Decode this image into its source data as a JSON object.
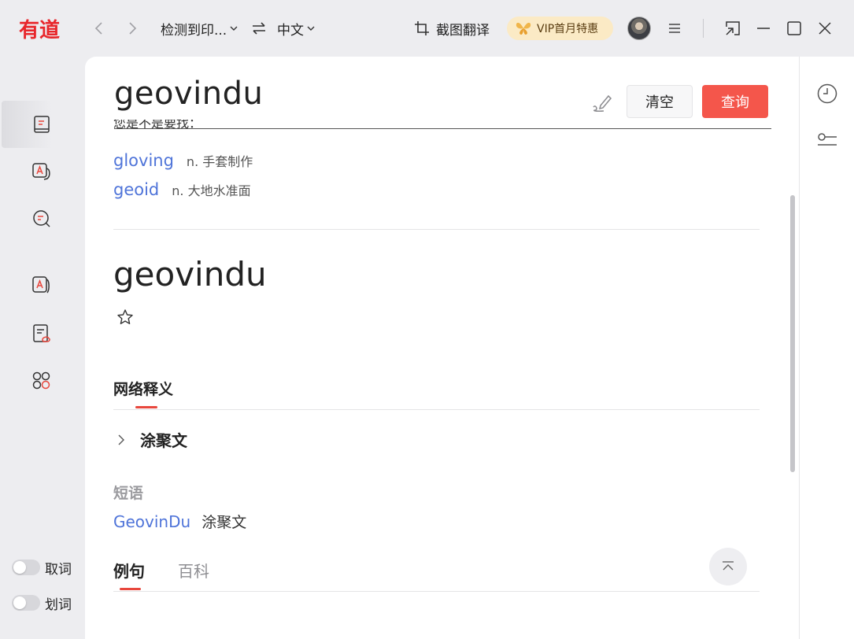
{
  "app": {
    "logo_text": "有道",
    "brand_color": "#e8262b",
    "accent_color": "#f4564b",
    "link_color": "#4f74d9"
  },
  "titlebar": {
    "source_lang": "检测到印...",
    "target_lang": "中文",
    "screenshot_label": "截图翻译",
    "vip_label": "VIP首月特惠",
    "icons": [
      "back-icon",
      "forward-icon",
      "swap-icon",
      "crop-icon",
      "butterfly-icon",
      "menu-icon",
      "mini-mode-icon",
      "minimize-icon",
      "maximize-icon",
      "close-icon"
    ]
  },
  "sidebar": {
    "items": [
      {
        "name": "dictionary",
        "icon": "dictionary-icon",
        "active": true
      },
      {
        "name": "translate",
        "icon": "translate-icon",
        "active": false
      },
      {
        "name": "ai-search",
        "icon": "ai-search-icon",
        "active": false
      },
      {
        "name": "word-book",
        "icon": "word-book-icon",
        "active": false
      },
      {
        "name": "document-translate",
        "icon": "document-icon",
        "active": false
      },
      {
        "name": "apps",
        "icon": "apps-icon",
        "active": false
      }
    ],
    "toggles": [
      {
        "label": "取词",
        "on": false
      },
      {
        "label": "划词",
        "on": false
      }
    ]
  },
  "search": {
    "query": "geovindu",
    "clear_label": "清空",
    "query_label": "查询"
  },
  "suggestions": {
    "heading": "您是不是要找：",
    "items": [
      {
        "word": "gloving",
        "definition": "n. 手套制作"
      },
      {
        "word": "geoid",
        "definition": "n. 大地水准面"
      }
    ]
  },
  "entry": {
    "headword": "geovindu",
    "web_meaning_title": "网络释义",
    "web_meanings": [
      "涂聚文"
    ],
    "phrase_title": "短语",
    "phrases": [
      {
        "word": "GeovinDu",
        "definition": "涂聚文"
      }
    ],
    "tabs": [
      {
        "label": "例句",
        "active": true
      },
      {
        "label": "百科",
        "active": false
      }
    ]
  },
  "rightbar": {
    "icons": [
      "history-icon",
      "settings-slider-icon"
    ]
  }
}
